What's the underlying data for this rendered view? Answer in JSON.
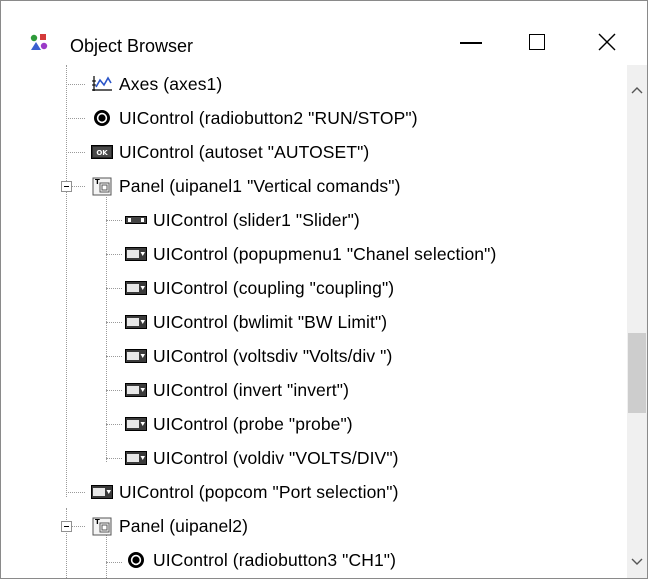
{
  "window": {
    "title": "Object Browser",
    "icon": "object-browser-icon",
    "controls": {
      "minimize": "minimize-icon",
      "maximize": "maximize-icon",
      "close": "close-icon"
    }
  },
  "tree": {
    "items": [
      {
        "label": "Axes (axes1)",
        "icon": "axes-icon"
      },
      {
        "label": "UIControl (radiobutton2 \"RUN/STOP\")",
        "icon": "radiobutton-icon"
      },
      {
        "label": "UIControl (autoset \"AUTOSET\")",
        "icon": "pushbutton-icon"
      },
      {
        "label": "Panel (uipanel1 \"Vertical comands\")",
        "icon": "panel-icon",
        "expanded": true
      },
      {
        "label": "UIControl (slider1 \"Slider\")",
        "icon": "slider-icon"
      },
      {
        "label": "UIControl (popupmenu1 \"Chanel selection\")",
        "icon": "popupmenu-icon"
      },
      {
        "label": "UIControl (coupling \"coupling\")",
        "icon": "popupmenu-icon"
      },
      {
        "label": "UIControl (bwlimit \"BW Limit\")",
        "icon": "popupmenu-icon"
      },
      {
        "label": "UIControl (voltsdiv \"Volts/div \")",
        "icon": "popupmenu-icon"
      },
      {
        "label": "UIControl (invert \"invert\")",
        "icon": "popupmenu-icon"
      },
      {
        "label": "UIControl (probe \"probe\")",
        "icon": "popupmenu-icon"
      },
      {
        "label": "UIControl (voldiv \"VOLTS/DIV\")",
        "icon": "popupmenu-icon"
      },
      {
        "label": "UIControl (popcom \"Port selection\")",
        "icon": "popupmenu-icon"
      },
      {
        "label": "Panel (uipanel2)",
        "icon": "panel-icon",
        "expanded": true
      },
      {
        "label": "UIControl (radiobutton3 \"CH1\")",
        "icon": "radiobutton-icon"
      }
    ]
  },
  "scrollbar": {
    "up": "scroll-up-arrow-icon",
    "down": "scroll-down-arrow-icon"
  },
  "colors": {
    "background": "#ffffff",
    "scroll_track": "#f0f0f0",
    "scroll_thumb": "#cdcdcd",
    "tree_lines": "#9a9a9a"
  }
}
